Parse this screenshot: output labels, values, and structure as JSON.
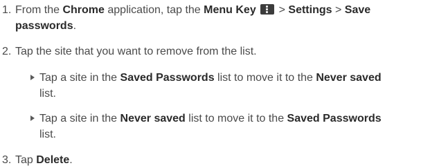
{
  "steps": [
    {
      "number": "1.",
      "segments": [
        {
          "text": "From the ",
          "bold": false
        },
        {
          "text": "Chrome",
          "bold": true
        },
        {
          "text": " application, tap the ",
          "bold": false
        },
        {
          "text": "Menu Key",
          "bold": true
        },
        {
          "icon": "menu-key-icon"
        },
        {
          "text": " > ",
          "bold": false
        },
        {
          "text": "Settings",
          "bold": true
        },
        {
          "text": " > ",
          "bold": false
        },
        {
          "text": "Save",
          "bold": true
        }
      ],
      "continuation": [
        {
          "text": "passwords",
          "bold": true
        },
        {
          "text": ".",
          "bold": false
        }
      ]
    },
    {
      "number": "2.",
      "text": "Tap the site that you want to remove from the list."
    },
    {
      "number": "3.",
      "segments": [
        {
          "text": "Tap ",
          "bold": false
        },
        {
          "text": "Delete",
          "bold": true
        },
        {
          "text": ".",
          "bold": false
        }
      ]
    }
  ],
  "bullets": [
    {
      "line1": [
        {
          "text": "Tap a site in the ",
          "bold": false
        },
        {
          "text": "Saved Passwords",
          "bold": true
        },
        {
          "text": " list to move it to the ",
          "bold": false
        },
        {
          "text": "Never saved",
          "bold": true
        }
      ],
      "line2": "list."
    },
    {
      "line1": [
        {
          "text": "Tap a site in the ",
          "bold": false
        },
        {
          "text": "Never saved",
          "bold": true
        },
        {
          "text": " list to move it to the ",
          "bold": false
        },
        {
          "text": "Saved Passwords",
          "bold": true
        }
      ],
      "line2": "list."
    }
  ]
}
